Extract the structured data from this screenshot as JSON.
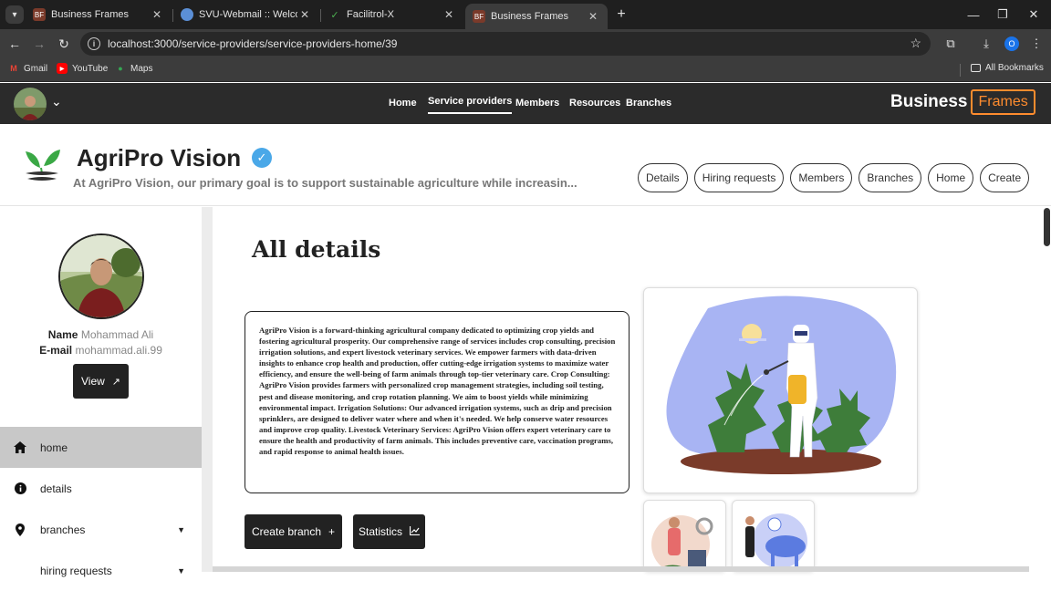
{
  "browser": {
    "tabs": [
      {
        "title": "Business Frames",
        "active": false
      },
      {
        "title": "SVU-Webmail :: Welcome",
        "active": false
      },
      {
        "title": "Facilitrol-X",
        "active": false
      },
      {
        "title": "Business Frames",
        "active": true
      }
    ],
    "url": "localhost:3000/service-providers/service-providers-home/39",
    "profile_initial": "O",
    "bookmarks": [
      "Gmail",
      "YouTube",
      "Maps"
    ],
    "all_bookmarks": "All Bookmarks"
  },
  "navbar": {
    "links": [
      "Home",
      "Service providers",
      "Members",
      "Resources",
      "Branches"
    ],
    "active_link": "Service providers",
    "brand_left": "Business",
    "brand_right": "Frames"
  },
  "company": {
    "name": "AgriPro Vision",
    "tagline": "At AgriPro Vision, our primary goal is to support sustainable agriculture while increasin...",
    "actions": [
      "Details",
      "Hiring requests",
      "Members",
      "Branches",
      "Home",
      "Create"
    ]
  },
  "sidebar": {
    "name_label": "Name",
    "name_value": "Mohammad Ali",
    "email_label": "E-mail",
    "email_value": "mohammad.ali.99",
    "view_label": "View",
    "menu": [
      {
        "label": "home",
        "icon": "home-icon",
        "active": true
      },
      {
        "label": "details",
        "icon": "info-icon",
        "active": false
      },
      {
        "label": "branches",
        "icon": "location-pin-icon",
        "active": false,
        "has_caret": true
      },
      {
        "label": "hiring requests",
        "icon": "",
        "active": false,
        "has_caret": true
      }
    ]
  },
  "main": {
    "title": "All details",
    "description": "AgriPro Vision is a forward-thinking agricultural company dedicated to optimizing crop yields and fostering agricultural prosperity. Our comprehensive range of services includes crop consulting, precision irrigation solutions, and expert livestock veterinary services. We empower farmers with data-driven insights to enhance crop health and production, offer cutting-edge irrigation systems to maximize water efficiency, and ensure the well-being of farm animals through top-tier veterinary care. Crop Consulting: AgriPro Vision provides farmers with personalized crop management strategies, including soil testing, pest and disease monitoring, and crop rotation planning. We aim to boost yields while minimizing environmental impact. Irrigation Solutions: Our advanced irrigation systems, such as drip and precision sprinklers, are designed to deliver water where and when it's needed. We help conserve water resources and improve crop quality. Livestock Veterinary Services: AgriPro Vision offers expert veterinary care to ensure the health and productivity of farm animals. This includes preventive care, vaccination programs, and rapid response to animal health issues.",
    "create_branch_label": "Create branch",
    "statistics_label": "Statistics"
  },
  "colors": {
    "navbar_bg": "#2b2b2b",
    "brand_accent": "#ff8c2e",
    "verified_blue": "#4aa8e8",
    "button_dark": "#222222",
    "active_menu_bg": "#c8c8c8"
  }
}
